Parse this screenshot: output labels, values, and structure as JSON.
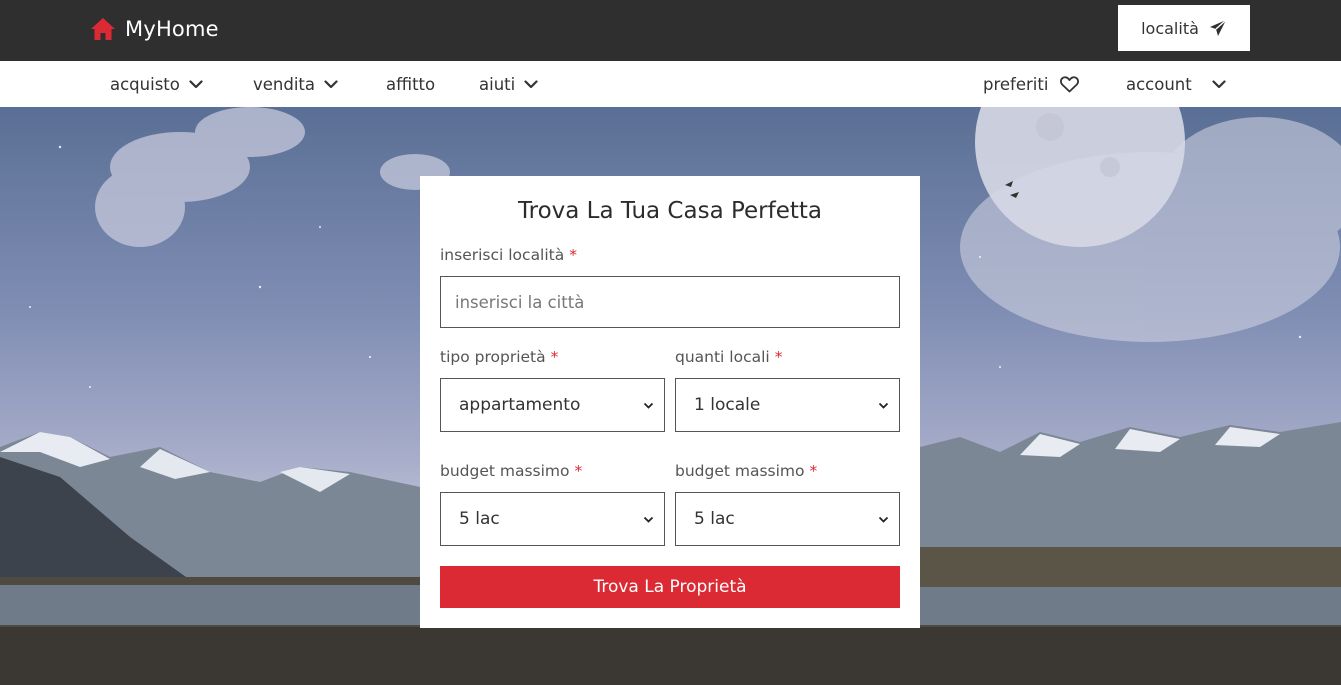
{
  "header": {
    "brand": "MyHome",
    "location_button": "località",
    "brand_color": "#dc2a34",
    "bar_color": "#2f2f2f"
  },
  "nav": {
    "left": [
      {
        "label": "acquisto",
        "has_dropdown": true
      },
      {
        "label": "vendita",
        "has_dropdown": true
      },
      {
        "label": "affitto",
        "has_dropdown": false
      },
      {
        "label": "aiuti",
        "has_dropdown": true
      }
    ],
    "right": [
      {
        "label": "preferiti",
        "icon": "heart-icon"
      },
      {
        "label": "account",
        "icon": "chevron-down-icon"
      }
    ]
  },
  "form": {
    "title": "Trova La Tua Casa Perfetta",
    "location_label": "inserisci località",
    "location_placeholder": "inserisci la città",
    "property_type_label": "tipo proprietà",
    "property_type_value": "appartamento",
    "rooms_label": "quanti locali",
    "rooms_value": "1 locale",
    "budget_label_1": "budget massimo",
    "budget_value_1": "5 lac",
    "budget_label_2": "budget massimo",
    "budget_value_2": "5 lac",
    "required_mark": "*",
    "submit_label": "Trova La Proprietà"
  }
}
